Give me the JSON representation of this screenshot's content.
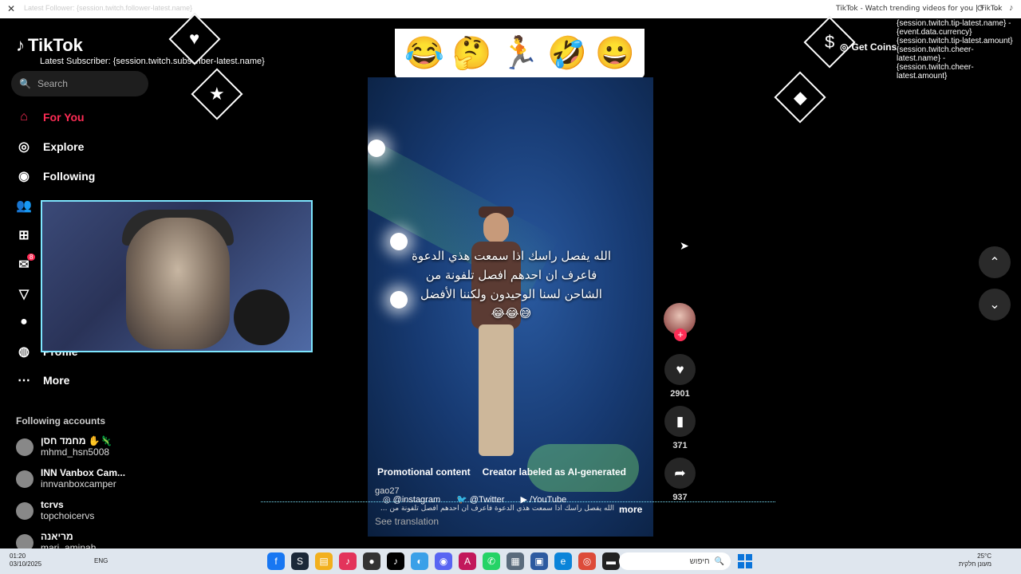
{
  "browser": {
    "close_glyph": "✕",
    "ghost_text": "Latest Follower: {session.twitch.follower-latest.name}",
    "tab_title": "TikTok - Watch trending videos for you | TikTok"
  },
  "sidebar": {
    "logo_text": "TikTok",
    "overlay_subscriber": "Latest Subscriber: {session.twitch.subscriber-latest.name}",
    "search_placeholder": "Search",
    "items": [
      {
        "label": "For You",
        "icon": "home-icon"
      },
      {
        "label": "Explore",
        "icon": "compass-icon"
      },
      {
        "label": "Following",
        "icon": "avatar-icon"
      },
      {
        "label": "",
        "icon": "friends-icon"
      },
      {
        "label": "",
        "icon": "upload-icon"
      },
      {
        "label": "",
        "icon": "messages-icon"
      },
      {
        "label": "",
        "icon": "activity-icon"
      },
      {
        "label": "",
        "icon": "live-icon"
      },
      {
        "label": "Profile",
        "icon": "profile-icon"
      },
      {
        "label": "More",
        "icon": "more-icon"
      }
    ],
    "messages_badge": "8",
    "following_title": "Following accounts",
    "accounts": [
      {
        "name": "מחמד חסן ✋🦎",
        "handle": "mhmd_hsn5008"
      },
      {
        "name": "INN Vanbox Cam...",
        "handle": "innvanboxcamper"
      },
      {
        "name": "tcrvs",
        "handle": "topchoicervs"
      },
      {
        "name": "מריאנה",
        "handle": "mari_aminah"
      }
    ]
  },
  "video": {
    "emojis": [
      "😂",
      "🤔",
      "🏃",
      "🤣",
      "😀"
    ],
    "caption_lines": [
      "الله يفصل راسك اذا سمعت هذي الدعوة",
      "فاعرف ان احدهم افصل تلفونة من",
      "الشاحن لسنا الوحيدون ولكننا الأفضل",
      "😅😂😂"
    ],
    "promo_label": "Promotional content",
    "ai_label": "Creator labeled as AI-generated",
    "author": "gao27",
    "socials": [
      "@instagram",
      "@Twitter",
      "/YouTube"
    ],
    "description": "الله يفصل راسك اذا سمعت هذي الدعوة فاعرف ان احدهم افصل تلفونة من ...",
    "more_label": "more",
    "see_translation": "See translation"
  },
  "actions": {
    "likes": "2901",
    "saves": "371",
    "shares": "937"
  },
  "overlay_right": {
    "get_coins": "Get Coins",
    "tip_text": "{session.twitch.tip-latest.name} - {event.data.currency}{session.twitch.tip-latest.amount} {session.twitch.cheer-latest.name} - {session.twitch.cheer-latest.amount}"
  },
  "taskbar": {
    "time": "01:20",
    "date": "03/10/2025",
    "lang": "ENG",
    "search_label": "חיפוש",
    "weather": "מעונן חלקית",
    "weather_temp": "25°C"
  }
}
